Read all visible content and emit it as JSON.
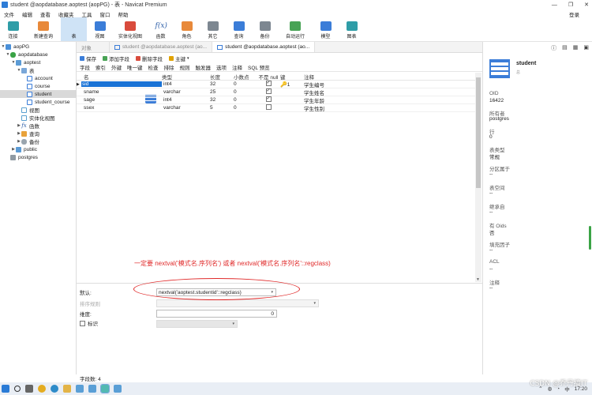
{
  "window": {
    "title": "student @aopdatabase.aoptest (aopPG) - 表 - Navicat Premium",
    "controls": [
      "—",
      "❐",
      "✕"
    ]
  },
  "menu": {
    "items": [
      "文件",
      "编辑",
      "查看",
      "收藏夹",
      "工具",
      "窗口",
      "帮助"
    ],
    "login": "登录"
  },
  "toolbar": {
    "buttons": [
      {
        "label": "连接",
        "icon": "connect-icon"
      },
      {
        "label": "新建查询",
        "icon": "new-query-icon"
      },
      {
        "label": "表",
        "icon": "table-icon"
      },
      {
        "label": "视图",
        "icon": "view-icon"
      },
      {
        "label": "实体化视图",
        "icon": "materialized-view-icon"
      },
      {
        "label": "函数",
        "icon": "function-icon"
      },
      {
        "label": "角色",
        "icon": "role-icon"
      },
      {
        "label": "其它",
        "icon": "other-icon"
      },
      {
        "label": "查询",
        "icon": "query-icon"
      },
      {
        "label": "备份",
        "icon": "backup-icon"
      },
      {
        "label": "自动运行",
        "icon": "automation-icon"
      },
      {
        "label": "模型",
        "icon": "model-icon"
      },
      {
        "label": "图表",
        "icon": "chart-icon"
      }
    ]
  },
  "tree": {
    "nodes": [
      {
        "label": "aopPG",
        "icon": "server-icon"
      },
      {
        "label": "aopdatabase",
        "icon": "database-icon"
      },
      {
        "label": "aoptest",
        "icon": "schema-icon"
      },
      {
        "label": "表",
        "icon": "tables-folder-icon"
      },
      {
        "label": "account",
        "icon": "table-icon"
      },
      {
        "label": "course",
        "icon": "table-icon"
      },
      {
        "label": "student",
        "icon": "table-icon"
      },
      {
        "label": "student_course",
        "icon": "table-icon"
      },
      {
        "label": "视图",
        "icon": "view-icon"
      },
      {
        "label": "实体化视图",
        "icon": "materialized-view-icon"
      },
      {
        "label": "函数",
        "icon": "function-icon"
      },
      {
        "label": "查询",
        "icon": "query-icon"
      },
      {
        "label": "备份",
        "icon": "backup-icon"
      },
      {
        "label": "public",
        "icon": "schema-icon"
      },
      {
        "label": "postgres",
        "icon": "database-icon"
      }
    ]
  },
  "tabs": {
    "object": "对象",
    "items": [
      "student @aopdatabase.aoptest (ao...",
      "student @aopdatabase.aoptest (ao..."
    ]
  },
  "editor": {
    "toolbar": {
      "save": "保存",
      "add_field": "添加字段",
      "delete_field": "删除字段",
      "primary_key": "主键"
    },
    "subtabs": [
      "字段",
      "索引",
      "外键",
      "唯一键",
      "检查",
      "排除",
      "规则",
      "触发器",
      "选项",
      "注释",
      "SQL 预览"
    ],
    "columns": [
      "名",
      "类型",
      "长度",
      "小数点",
      "不是 null",
      "键",
      "注释"
    ],
    "rows": [
      {
        "name": "sid",
        "type": "int4",
        "length": "32",
        "decimal": "0",
        "not_null": true,
        "key": "1",
        "comment": "学生编号"
      },
      {
        "name": "sname",
        "type": "varchar",
        "length": "25",
        "decimal": "0",
        "not_null": true,
        "key": "",
        "comment": "学生姓名"
      },
      {
        "name": "sage",
        "type": "int4",
        "length": "32",
        "decimal": "0",
        "not_null": true,
        "key": "",
        "comment": "学生年龄"
      },
      {
        "name": "ssex",
        "type": "varchar",
        "length": "5",
        "decimal": "0",
        "not_null": false,
        "key": "",
        "comment": "学生性别"
      }
    ]
  },
  "annotation": {
    "text": "一定要 nextval('模式名.序列名') 或者 nextval('模式名.序列名'::regclass)"
  },
  "props": {
    "default_label": "默认:",
    "default_value": "nextval('aoptest.studentid'::regclass)",
    "collation_label": "排序规则",
    "dimension_label": "维度:",
    "dimension_value": "0",
    "identity_label": "标识"
  },
  "right_panel": {
    "name": "student",
    "sub": "总",
    "fields": [
      {
        "label": "OID",
        "value": "16422"
      },
      {
        "label": "所有者",
        "value": "postgres"
      },
      {
        "label": "行",
        "value": "0"
      },
      {
        "label": "表类型",
        "value": "常规"
      },
      {
        "label": "分区属于",
        "value": "--"
      },
      {
        "label": "表空间",
        "value": "--"
      },
      {
        "label": "继承自",
        "value": "--"
      },
      {
        "label": "有 Oids",
        "value": "否"
      },
      {
        "label": "填充因子",
        "value": "--"
      },
      {
        "label": "ACL",
        "value": "--"
      },
      {
        "label": "注释",
        "value": "--"
      }
    ]
  },
  "status": {
    "field_count": "字段数: 4"
  },
  "taskbar": {
    "time": "17:20",
    "lang": "中"
  },
  "watermark": "CSDN @乔丹搞IT"
}
